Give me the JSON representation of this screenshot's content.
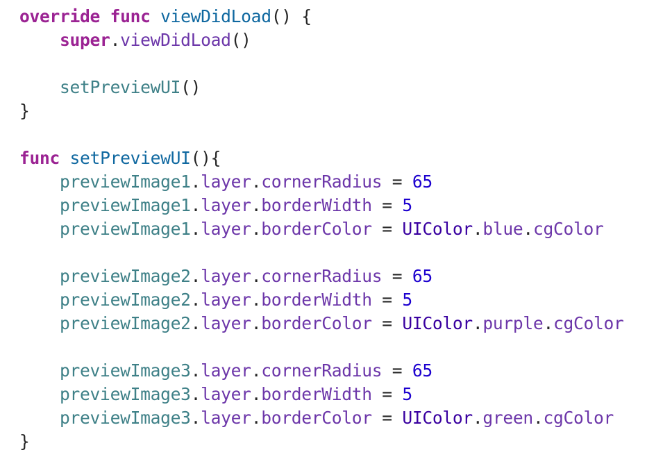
{
  "colors": {
    "background": "#ffffff",
    "keyword": "#9b2393",
    "function_declaration": "#0f68a0",
    "project_identifier": "#3e8087",
    "property": "#6c36a9",
    "type": "#3900a0",
    "number": "#1c00cf",
    "plain": "#262626"
  },
  "lines": [
    [
      {
        "t": "override",
        "c": "kw"
      },
      {
        "t": " ",
        "c": "plain"
      },
      {
        "t": "func",
        "c": "kw"
      },
      {
        "t": " ",
        "c": "plain"
      },
      {
        "t": "viewDidLoad",
        "c": "fn-decl"
      },
      {
        "t": "() {",
        "c": "plain"
      }
    ],
    [
      {
        "t": "    ",
        "c": "plain"
      },
      {
        "t": "super",
        "c": "kw"
      },
      {
        "t": ".",
        "c": "plain"
      },
      {
        "t": "viewDidLoad",
        "c": "prop"
      },
      {
        "t": "()",
        "c": "plain"
      }
    ],
    [],
    [
      {
        "t": "    ",
        "c": "plain"
      },
      {
        "t": "setPreviewUI",
        "c": "fn-call"
      },
      {
        "t": "()",
        "c": "plain"
      }
    ],
    [
      {
        "t": "}",
        "c": "plain"
      }
    ],
    [],
    [
      {
        "t": "func",
        "c": "kw"
      },
      {
        "t": " ",
        "c": "plain"
      },
      {
        "t": "setPreviewUI",
        "c": "fn-decl"
      },
      {
        "t": "(){",
        "c": "plain"
      }
    ],
    [
      {
        "t": "    ",
        "c": "plain"
      },
      {
        "t": "previewImage1",
        "c": "id"
      },
      {
        "t": ".",
        "c": "plain"
      },
      {
        "t": "layer",
        "c": "prop"
      },
      {
        "t": ".",
        "c": "plain"
      },
      {
        "t": "cornerRadius",
        "c": "prop"
      },
      {
        "t": " = ",
        "c": "plain"
      },
      {
        "t": "65",
        "c": "num"
      }
    ],
    [
      {
        "t": "    ",
        "c": "plain"
      },
      {
        "t": "previewImage1",
        "c": "id"
      },
      {
        "t": ".",
        "c": "plain"
      },
      {
        "t": "layer",
        "c": "prop"
      },
      {
        "t": ".",
        "c": "plain"
      },
      {
        "t": "borderWidth",
        "c": "prop"
      },
      {
        "t": " = ",
        "c": "plain"
      },
      {
        "t": "5",
        "c": "num"
      }
    ],
    [
      {
        "t": "    ",
        "c": "plain"
      },
      {
        "t": "previewImage1",
        "c": "id"
      },
      {
        "t": ".",
        "c": "plain"
      },
      {
        "t": "layer",
        "c": "prop"
      },
      {
        "t": ".",
        "c": "plain"
      },
      {
        "t": "borderColor",
        "c": "prop"
      },
      {
        "t": " = ",
        "c": "plain"
      },
      {
        "t": "UIColor",
        "c": "type"
      },
      {
        "t": ".",
        "c": "plain"
      },
      {
        "t": "blue",
        "c": "prop"
      },
      {
        "t": ".",
        "c": "plain"
      },
      {
        "t": "cgColor",
        "c": "prop"
      }
    ],
    [],
    [
      {
        "t": "    ",
        "c": "plain"
      },
      {
        "t": "previewImage2",
        "c": "id"
      },
      {
        "t": ".",
        "c": "plain"
      },
      {
        "t": "layer",
        "c": "prop"
      },
      {
        "t": ".",
        "c": "plain"
      },
      {
        "t": "cornerRadius",
        "c": "prop"
      },
      {
        "t": " = ",
        "c": "plain"
      },
      {
        "t": "65",
        "c": "num"
      }
    ],
    [
      {
        "t": "    ",
        "c": "plain"
      },
      {
        "t": "previewImage2",
        "c": "id"
      },
      {
        "t": ".",
        "c": "plain"
      },
      {
        "t": "layer",
        "c": "prop"
      },
      {
        "t": ".",
        "c": "plain"
      },
      {
        "t": "borderWidth",
        "c": "prop"
      },
      {
        "t": " = ",
        "c": "plain"
      },
      {
        "t": "5",
        "c": "num"
      }
    ],
    [
      {
        "t": "    ",
        "c": "plain"
      },
      {
        "t": "previewImage2",
        "c": "id"
      },
      {
        "t": ".",
        "c": "plain"
      },
      {
        "t": "layer",
        "c": "prop"
      },
      {
        "t": ".",
        "c": "plain"
      },
      {
        "t": "borderColor",
        "c": "prop"
      },
      {
        "t": " = ",
        "c": "plain"
      },
      {
        "t": "UIColor",
        "c": "type"
      },
      {
        "t": ".",
        "c": "plain"
      },
      {
        "t": "purple",
        "c": "prop"
      },
      {
        "t": ".",
        "c": "plain"
      },
      {
        "t": "cgColor",
        "c": "prop"
      }
    ],
    [],
    [
      {
        "t": "    ",
        "c": "plain"
      },
      {
        "t": "previewImage3",
        "c": "id"
      },
      {
        "t": ".",
        "c": "plain"
      },
      {
        "t": "layer",
        "c": "prop"
      },
      {
        "t": ".",
        "c": "plain"
      },
      {
        "t": "cornerRadius",
        "c": "prop"
      },
      {
        "t": " = ",
        "c": "plain"
      },
      {
        "t": "65",
        "c": "num"
      }
    ],
    [
      {
        "t": "    ",
        "c": "plain"
      },
      {
        "t": "previewImage3",
        "c": "id"
      },
      {
        "t": ".",
        "c": "plain"
      },
      {
        "t": "layer",
        "c": "prop"
      },
      {
        "t": ".",
        "c": "plain"
      },
      {
        "t": "borderWidth",
        "c": "prop"
      },
      {
        "t": " = ",
        "c": "plain"
      },
      {
        "t": "5",
        "c": "num"
      }
    ],
    [
      {
        "t": "    ",
        "c": "plain"
      },
      {
        "t": "previewImage3",
        "c": "id"
      },
      {
        "t": ".",
        "c": "plain"
      },
      {
        "t": "layer",
        "c": "prop"
      },
      {
        "t": ".",
        "c": "plain"
      },
      {
        "t": "borderColor",
        "c": "prop"
      },
      {
        "t": " = ",
        "c": "plain"
      },
      {
        "t": "UIColor",
        "c": "type"
      },
      {
        "t": ".",
        "c": "plain"
      },
      {
        "t": "green",
        "c": "prop"
      },
      {
        "t": ".",
        "c": "plain"
      },
      {
        "t": "cgColor",
        "c": "prop"
      }
    ],
    [
      {
        "t": "}",
        "c": "plain"
      }
    ]
  ]
}
